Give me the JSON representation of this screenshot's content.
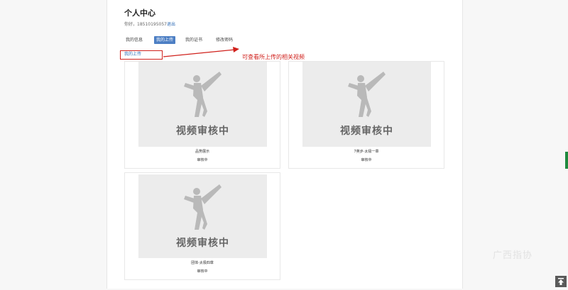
{
  "page": {
    "title": "个人中心"
  },
  "user": {
    "greeting": "你好，18510195057",
    "logout": "退出"
  },
  "tabs": [
    {
      "label": "我的信息"
    },
    {
      "label": "我的上传"
    },
    {
      "label": "我的证书"
    },
    {
      "label": "修改密码"
    }
  ],
  "subtab": {
    "label": "我的上传"
  },
  "annotation": {
    "text": "可查看所上传的相关视频"
  },
  "videos": [
    {
      "thumb_text": "视频审核中",
      "name": "品势展示",
      "status": "审核中"
    },
    {
      "thumb_text": "视频审核中",
      "name": "7英步-太极一章",
      "status": "审核中"
    },
    {
      "thumb_text": "视频审核中",
      "name": "团体-太极四章",
      "status": "审核中"
    }
  ],
  "watermark": {
    "text": "广西指协"
  },
  "colors": {
    "accent": "#4d7fc4",
    "annotation": "#d0211c",
    "link": "#2d6bb5"
  },
  "icons": {
    "back_to_top": "arrow-up-icon",
    "thumbnail": "taekwondo-kick-icon"
  }
}
